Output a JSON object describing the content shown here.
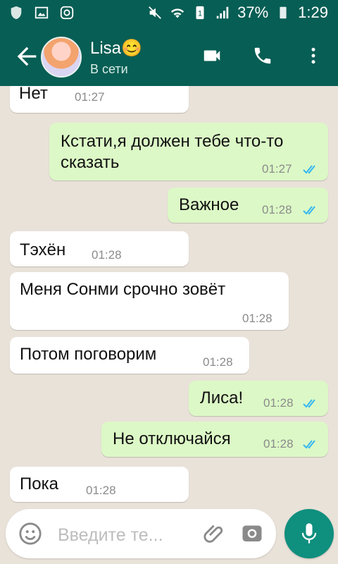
{
  "status_bar": {
    "battery_percent": "37%",
    "time": "1:29",
    "icons": [
      "shield-icon",
      "image-icon",
      "instagram-icon",
      "mute-icon",
      "wifi-icon",
      "sim-icon",
      "signal-icon",
      "battery-icon"
    ]
  },
  "header": {
    "contact_name": "Lisa😊",
    "status": "В сети",
    "actions": [
      "video-call-icon",
      "voice-call-icon",
      "more-options-icon"
    ]
  },
  "messages": [
    {
      "direction": "in",
      "text": "Нет",
      "time": "01:27"
    },
    {
      "direction": "out",
      "text": "Кстати,я должен тебе что-то сказать",
      "time": "01:27",
      "read": true
    },
    {
      "direction": "out",
      "text": "Важное",
      "time": "01:28",
      "read": true
    },
    {
      "direction": "in",
      "text": "Тэхён",
      "time": "01:28"
    },
    {
      "direction": "in",
      "text": "Меня Сонми срочно зовёт",
      "time": "01:28"
    },
    {
      "direction": "in",
      "text": "Потом поговорим",
      "time": "01:28"
    },
    {
      "direction": "out",
      "text": "Лиса!",
      "time": "01:28",
      "read": true
    },
    {
      "direction": "out",
      "text": "Не отключайся",
      "time": "01:28",
      "read": true
    },
    {
      "direction": "in",
      "text": "Пока",
      "time": "01:28"
    }
  ],
  "composer": {
    "placeholder": "Введите те..."
  },
  "colors": {
    "header": "#075e54",
    "outgoing_bubble": "#dcf8c6",
    "incoming_bubble": "#ffffff",
    "read_ticks": "#34b7f1",
    "mic_button": "#0f8f7e"
  }
}
